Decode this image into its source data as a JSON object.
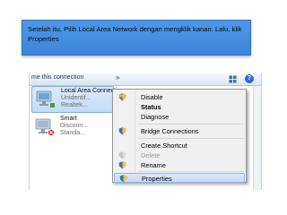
{
  "banner": {
    "text": "Setelah itu, Pilih Local Area Network dengan mengklik kanan. Lalu, klik Properties"
  },
  "toolbar": {
    "label": "me this connection",
    "more": "»"
  },
  "adapters": [
    {
      "name": "Local Area Connection",
      "line1": "Unidentif...",
      "line2": "Realtek..."
    },
    {
      "name": "Smart",
      "line1": "Disconn...",
      "line2": "Standa..."
    }
  ],
  "menu": {
    "items": [
      {
        "label": "Disable"
      },
      {
        "label": "Status"
      },
      {
        "label": "Diagnose"
      },
      {
        "label": "Bridge Connections"
      },
      {
        "label": "Create Shortcut"
      },
      {
        "label": "Delete"
      },
      {
        "label": "Rename"
      },
      {
        "label": "Properties"
      }
    ]
  },
  "colors": {
    "banner": "#4a92e2",
    "selection": "#c8ddf6",
    "shield_blue": "#2f6fd6",
    "shield_yellow": "#f5c21a"
  }
}
